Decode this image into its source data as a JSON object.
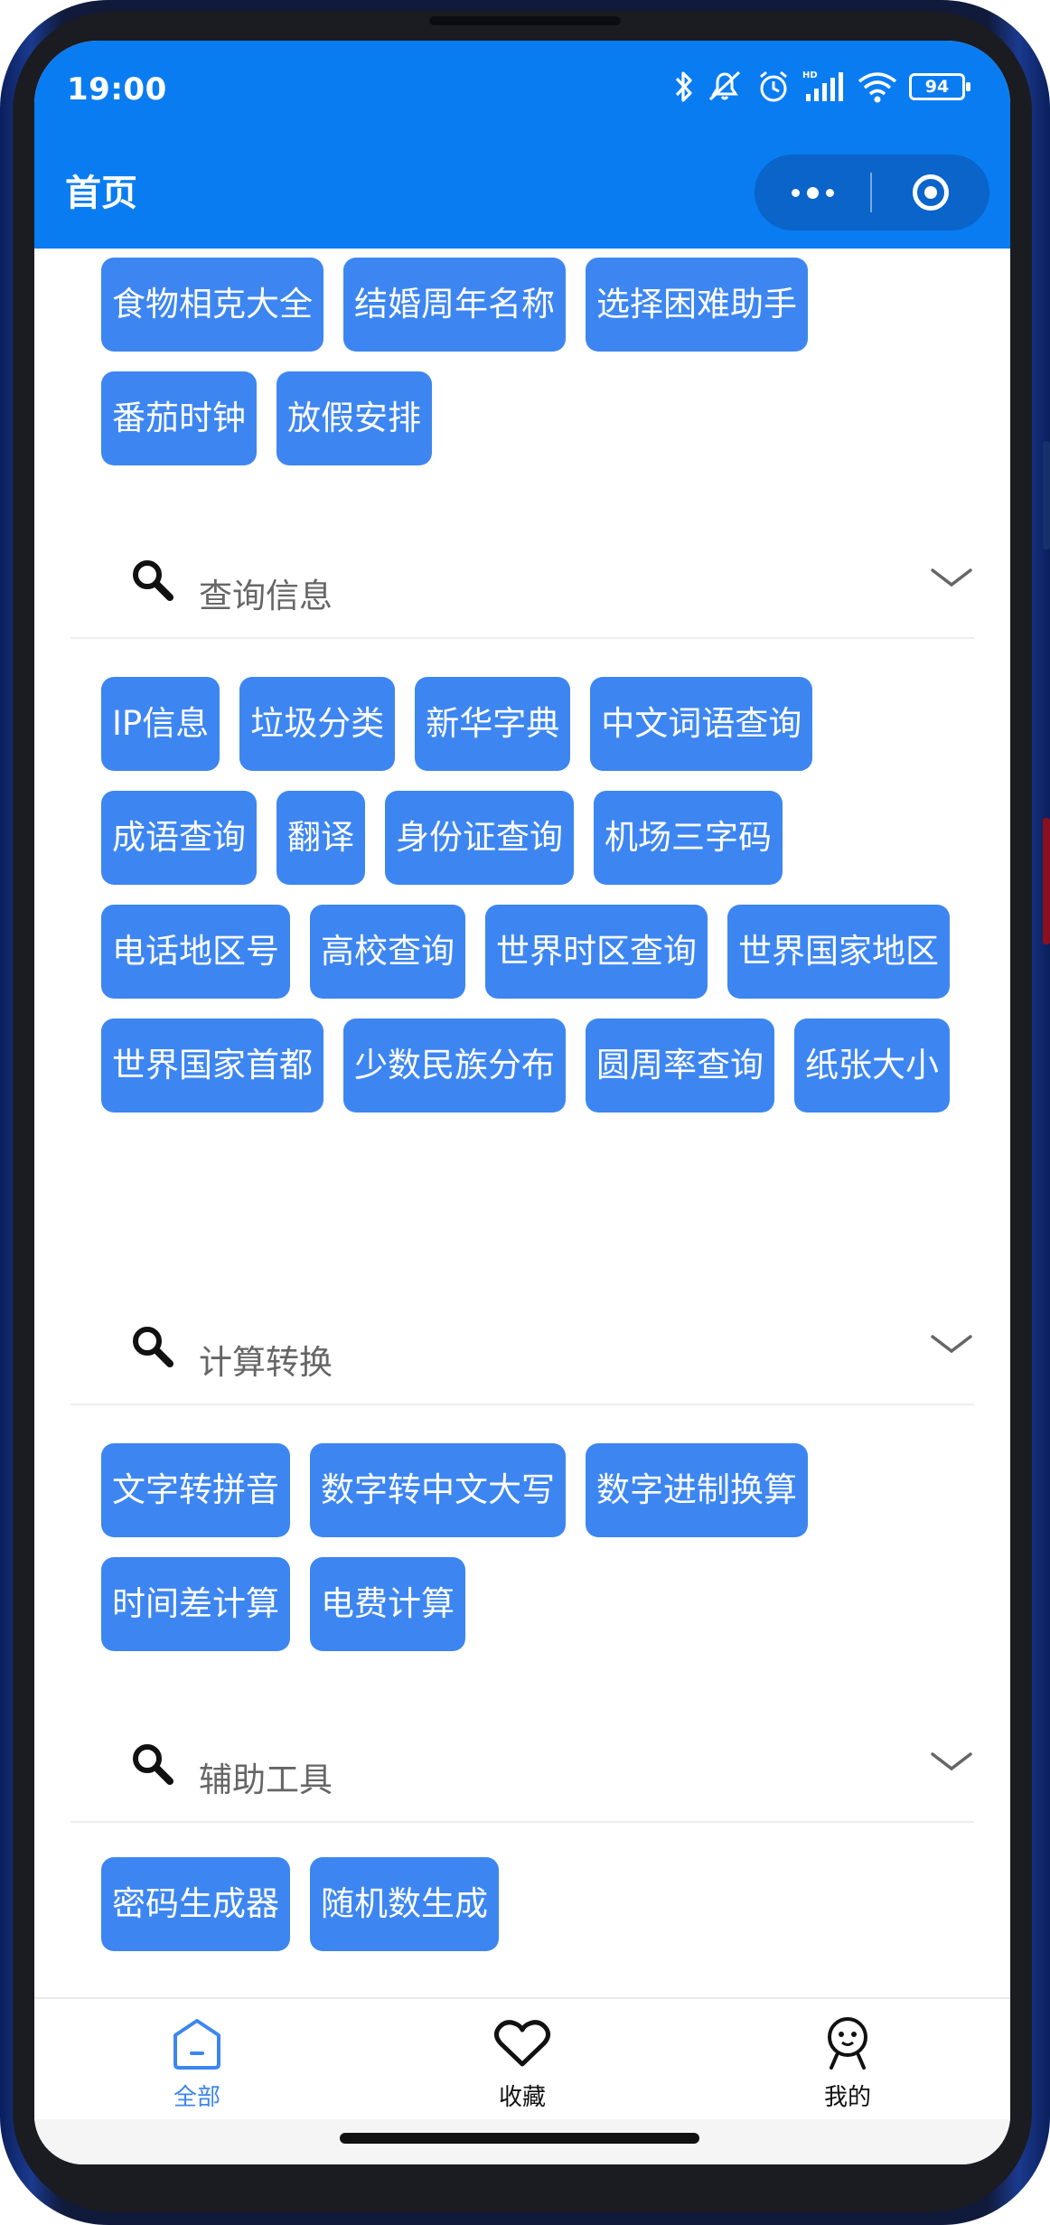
{
  "status_bar": {
    "time": "19:00",
    "battery": "94",
    "icons": [
      "bluetooth-icon",
      "mute-icon",
      "alarm-icon",
      "hd-signal-icon",
      "wifi-icon",
      "battery-icon"
    ]
  },
  "nav": {
    "title": "首页",
    "capsule": [
      "more-icon",
      "close-target-icon"
    ]
  },
  "colors": {
    "primary": "#0a7cf1",
    "tag": "#3d86f1",
    "tab_active": "#3d86f1"
  },
  "sections": [
    {
      "title": "",
      "tags": [
        "食物相克大全",
        "结婚周年名称",
        "选择困难助手",
        "番茄时钟",
        "放假安排"
      ]
    },
    {
      "title": "查询信息",
      "tags": [
        "IP信息",
        "垃圾分类",
        "新华字典",
        "中文词语查询",
        "成语查询",
        "翻译",
        "身份证查询",
        "机场三字码",
        "电话地区号",
        "高校查询",
        "世界时区查询",
        "世界国家地区",
        "世界国家首都",
        "少数民族分布",
        "圆周率查询",
        "纸张大小"
      ]
    },
    {
      "title": "计算转换",
      "tags": [
        "文字转拼音",
        "数字转中文大写",
        "数字进制换算",
        "时间差计算",
        "电费计算"
      ]
    },
    {
      "title": "辅助工具",
      "tags": [
        "密码生成器",
        "随机数生成"
      ]
    }
  ],
  "tabbar": {
    "items": [
      {
        "label": "全部",
        "icon": "home-icon",
        "active": true
      },
      {
        "label": "收藏",
        "icon": "heart-icon",
        "active": false
      },
      {
        "label": "我的",
        "icon": "profile-icon",
        "active": false
      }
    ]
  }
}
